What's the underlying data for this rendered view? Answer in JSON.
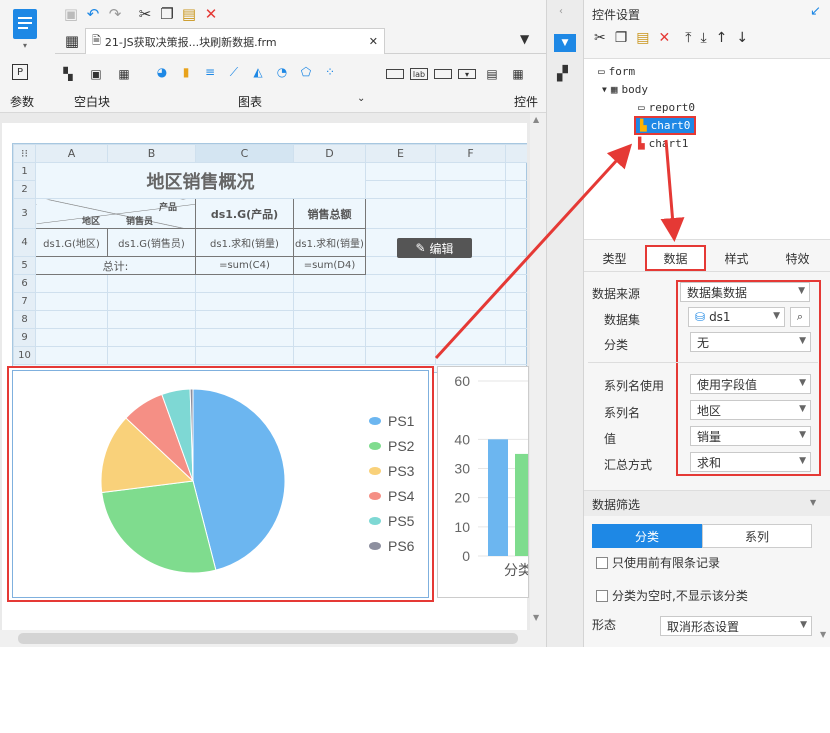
{
  "toolbar": {
    "quick_icons": [
      "save-icon",
      "undo-icon",
      "redo-icon",
      "cut-icon",
      "copy-icon",
      "paste-icon",
      "delete-icon"
    ]
  },
  "tab": {
    "title": "21-JS获取决策报...块刷新数据.frm",
    "close": "✕"
  },
  "ribbon": {
    "group_params": "参数",
    "group_blank": "空白块",
    "group_chart": "图表",
    "group_widget": "控件"
  },
  "sheet": {
    "columns": [
      "A",
      "B",
      "C",
      "D",
      "E",
      "F"
    ],
    "rows": [
      "1",
      "2",
      "3",
      "4",
      "5",
      "6",
      "7",
      "8",
      "9",
      "10"
    ],
    "title": "地区销售概况",
    "diag_product": "产品",
    "diag_seller": "销售员",
    "diag_region": "地区",
    "c3": "ds1.G(产品)",
    "d3": "销售总额",
    "a4": "ds1.G(地区)",
    "b4": "ds1.G(销售员)",
    "c4": "ds1.求和(销量)",
    "d4": "ds1.求和(销量)",
    "a5": "总计:",
    "c5": "=sum(C4)",
    "d5": "=sum(D4)"
  },
  "edit_button": "编辑",
  "chart_data": [
    {
      "type": "pie",
      "categories": [
        "PS1",
        "PS2",
        "PS3",
        "PS4",
        "PS5",
        "PS6"
      ],
      "values": [
        46,
        27,
        14,
        7.5,
        5,
        0.5
      ],
      "colors": [
        "#6cb6f0",
        "#7fdc8e",
        "#f9d17a",
        "#f58f85",
        "#7ed8d4",
        "#8d8f9f"
      ]
    },
    {
      "type": "bar",
      "yticks": [
        "0",
        "10",
        "20",
        "30",
        "40",
        "60"
      ],
      "ylim": [
        0,
        60
      ],
      "values": [
        40,
        35
      ],
      "colors": [
        "#6cb6f0",
        "#7fdc8e"
      ],
      "xlabel": "分类"
    }
  ],
  "panel": {
    "title": "控件设置",
    "tree": {
      "form": "form",
      "body": "body",
      "report0": "report0",
      "chart0": "chart0",
      "chart1": "chart1"
    },
    "tabs": [
      "类型",
      "数据",
      "样式",
      "特效"
    ],
    "fields": {
      "source_label": "数据来源",
      "source_value": "数据集数据",
      "dataset_label": "数据集",
      "dataset_value": "ds1",
      "category_label": "分类",
      "category_value": "无",
      "series_name_use_label": "系列名使用",
      "series_name_use_value": "使用字段值",
      "series_name_label": "系列名",
      "series_name_value": "地区",
      "value_label": "值",
      "value_value": "销量",
      "agg_label": "汇总方式",
      "agg_value": "求和"
    },
    "filter": {
      "title": "数据筛选",
      "seg_category": "分类",
      "seg_series": "系列",
      "check_top": "只使用前有限条记录",
      "check_empty": "分类为空时,不显示该分类"
    },
    "shape": {
      "label": "形态",
      "value": "取消形态设置"
    }
  },
  "colors": {
    "accent": "#1e88e5",
    "highlight": "#e53935"
  }
}
